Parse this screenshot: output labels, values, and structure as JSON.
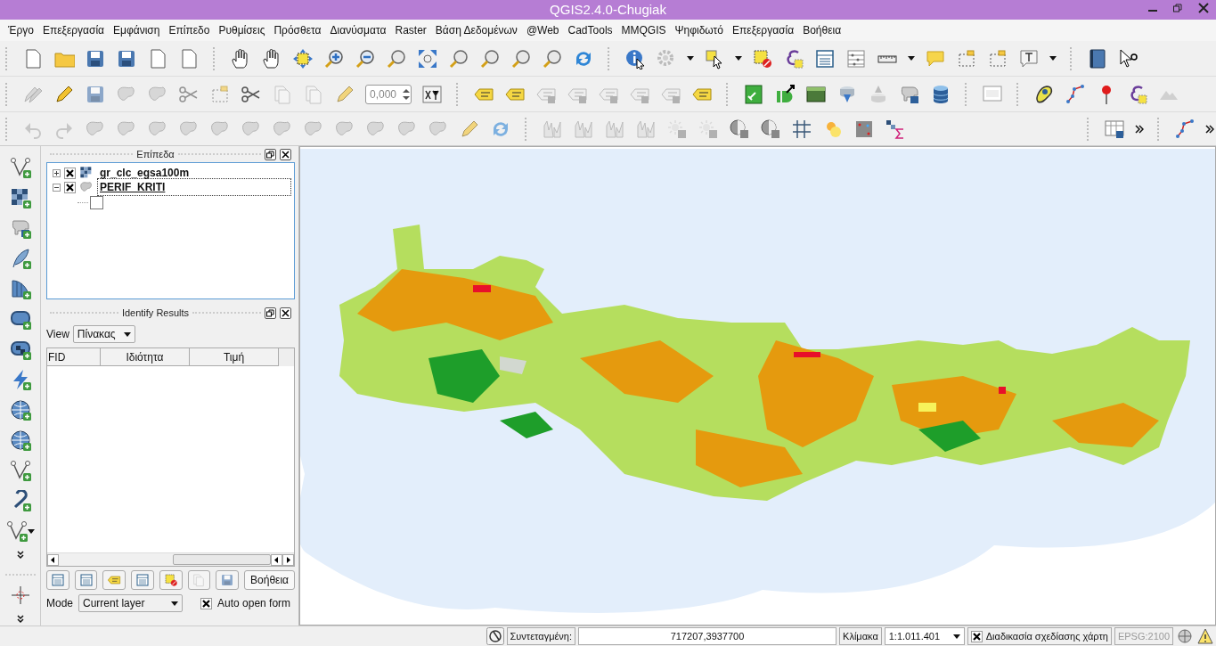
{
  "window": {
    "title": "QGIS2.4.0-Chugiak"
  },
  "menu": [
    "Έργο",
    "Επεξεργασία",
    "Εμφάνιση",
    "Επίπεδο",
    "Ρυθμίσεις",
    "Πρόσθετα",
    "Διανύσματα",
    "Raster",
    "Βάση Δεδομένων",
    "@Web",
    "CadTools",
    "MMQGIS",
    "Ψηφιδωτό",
    "Επεξεργασία",
    "Βοήθεια"
  ],
  "toolbar": {
    "snapping_value": "0,000"
  },
  "layers_panel": {
    "title": "Επίπεδα",
    "layers": [
      {
        "name": "gr_clc_egsa100m",
        "kind": "raster",
        "visible": true,
        "expanded": false,
        "selected": false
      },
      {
        "name": "PERIF_KRITI",
        "kind": "polygon",
        "visible": true,
        "expanded": true,
        "selected": true
      }
    ]
  },
  "identify_panel": {
    "title": "Identify Results",
    "view_label": "View",
    "view_value": "Πίνακας",
    "columns": [
      "FID",
      "Ιδιότητα",
      "Τιμή"
    ],
    "help_button": "Βοήθεια",
    "mode_label": "Mode",
    "mode_value": "Current layer",
    "auto_open_form": {
      "label": "Auto open form",
      "checked": true
    }
  },
  "status_bar": {
    "coordinate_label": "Συντεταγμένη:",
    "coordinate_value": "717207,3937700",
    "scale_label": "Κλίμακα",
    "scale_value": "1:1.011.401",
    "render": {
      "label": "Διαδικασία σχεδίασης χάρτη",
      "checked": true
    },
    "crs": "EPSG:2100"
  }
}
